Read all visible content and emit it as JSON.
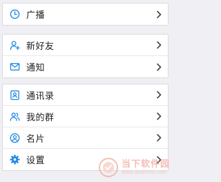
{
  "colors": {
    "accent": "#1e88e5",
    "background": "#efeff4",
    "text": "#222222",
    "chevron": "#444444"
  },
  "groups": [
    {
      "items": [
        {
          "label": "广播",
          "icon": "clock-icon"
        }
      ]
    },
    {
      "items": [
        {
          "label": "新好友",
          "icon": "add-friend-icon"
        },
        {
          "label": "通知",
          "icon": "mail-icon"
        }
      ]
    },
    {
      "items": [
        {
          "label": "通讯录",
          "icon": "contacts-icon"
        },
        {
          "label": "我的群",
          "icon": "group-icon"
        },
        {
          "label": "名片",
          "icon": "user-circle-icon"
        },
        {
          "label": "设置",
          "icon": "gear-icon"
        }
      ]
    }
  ],
  "watermark": {
    "cn": "当下软件园",
    "en": "www.downxia.com"
  }
}
